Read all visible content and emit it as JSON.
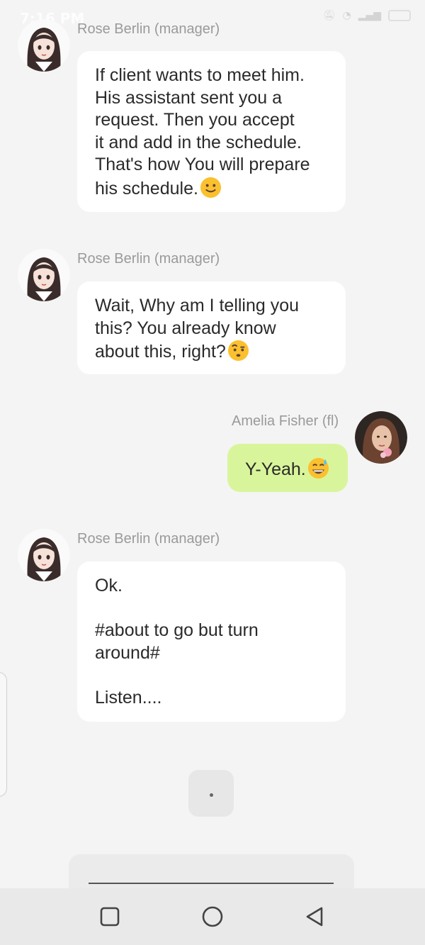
{
  "status_bar": {
    "time": "7:16 PM",
    "icons": [
      "silent-icon",
      "wifi-icon",
      "signal-icon",
      "battery-icon"
    ]
  },
  "messages": [
    {
      "sender": "Rose Berlin (manager)",
      "text": "If client wants to meet him.\nHis assistant sent you a\nrequest. Then you accept\nit and add in the schedule.\nThat's how You will prepare\nhis schedule.",
      "emoji": "slightly-smiling-face-icon",
      "direction": "incoming"
    },
    {
      "sender": "Rose Berlin (manager)",
      "text": "Wait, Why am I telling you\nthis? You already know\nabout this, right?",
      "emoji": "face-with-raised-eyebrow-icon",
      "direction": "incoming"
    },
    {
      "sender": "Amelia Fisher (fl)",
      "text": "Y-Yeah.",
      "emoji": "grinning-face-with-sweat-icon",
      "direction": "outgoing"
    },
    {
      "sender": "Rose Berlin (manager)",
      "text": "Ok.\n\n#about to go but turn\naround#\n\nListen....",
      "direction": "incoming"
    }
  ],
  "typing_indicator": ".",
  "colors": {
    "background": "#f4f4f4",
    "incoming_bubble": "#ffffff",
    "outgoing_bubble": "#d9f59b",
    "sender_name": "#9a9a9a"
  },
  "nav_bar": {
    "buttons": [
      "recent-apps-icon",
      "home-icon",
      "back-icon"
    ]
  }
}
